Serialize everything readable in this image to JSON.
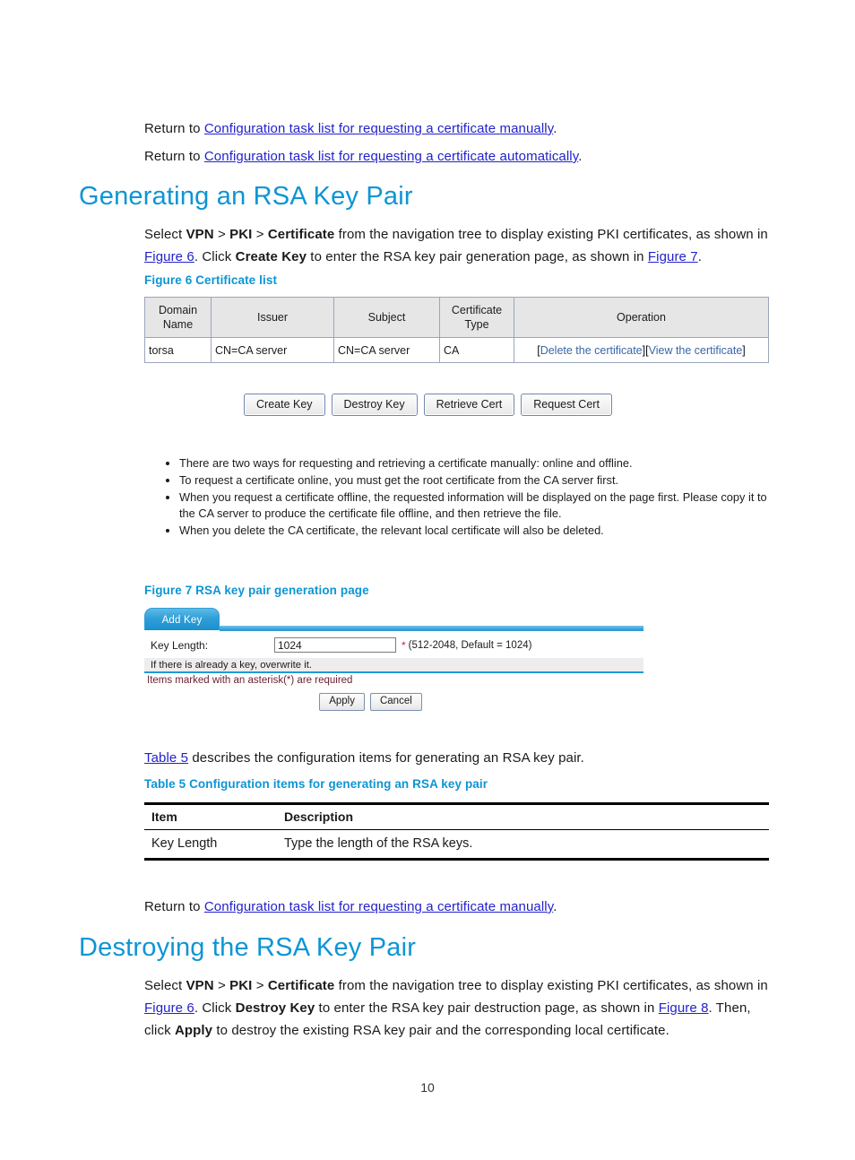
{
  "intro": {
    "return_line_1_prefix": "Return to ",
    "return_link_1": "Configuration task list for requesting a certificate manually",
    "return_line_1_suffix": ".",
    "return_line_2_prefix": "Return to ",
    "return_link_2": "Configuration task list for requesting a certificate automatically",
    "return_line_2_suffix": "."
  },
  "section_generating": {
    "heading": "Generating an RSA Key Pair",
    "body_1": "Select ",
    "nav_vpn": "VPN",
    "sep_1": " > ",
    "nav_pki": "PKI",
    "sep_2": " > ",
    "nav_certificate": "Certificate",
    "body_2": " from the navigation tree to display existing PKI certificates, as shown in ",
    "xref_figure6": "Figure 6",
    "body_3": ". Click ",
    "action_create_key": "Create Key",
    "body_4": " to enter the RSA key pair generation page, as shown in ",
    "xref_figure7": "Figure 7",
    "body_5": "."
  },
  "figure6": {
    "caption": "Figure 6 Certificate list",
    "table": {
      "headers": [
        "Domain Name",
        "Issuer",
        "Subject",
        "Certificate Type",
        "Operation"
      ],
      "rows": [
        {
          "domain_name": "torsa",
          "issuer": "CN=CA server",
          "subject": "CN=CA server",
          "certificate_type": "CA",
          "operations": [
            "Delete the certificate",
            "View the certificate"
          ]
        }
      ]
    },
    "buttons": [
      "Create Key",
      "Destroy Key",
      "Retrieve Cert",
      "Request Cert"
    ],
    "notes": [
      "There are two ways for requesting and retrieving a certificate manually: online and offline.",
      "To request a certificate online, you must get the root certificate from the CA server first.",
      "When you request a certificate offline, the requested information will be displayed on the page first. Please copy it to the CA server to produce the certificate file offline, and then retrieve the file.",
      "When you delete the CA certificate, the relevant local certificate will also be deleted."
    ]
  },
  "figure7": {
    "caption": "Figure 7 RSA key pair generation page",
    "tab_label": "Add Key",
    "key_length_label": "Key Length:",
    "key_length_value": "1024",
    "key_length_placeholder": "1024",
    "required_marker": "*",
    "key_length_hint": "(512-2048, Default = 1024)",
    "overwrite_note": "If there is already a key, overwrite it.",
    "asterisk_note": "Items marked with an asterisk(*) are required",
    "apply_label": "Apply",
    "cancel_label": "Cancel"
  },
  "table5_intro": {
    "xref_table5": "Table 5",
    "text": " describes the configuration items for generating an RSA key pair."
  },
  "table5": {
    "caption": "Table 5 Configuration items for generating an RSA key pair",
    "headers": [
      "Item",
      "Description"
    ],
    "rows": [
      {
        "item": "Key Length",
        "description": "Type the length of the RSA keys."
      }
    ]
  },
  "return_mid": {
    "prefix": "Return to ",
    "link": "Configuration task list for requesting a certificate manually",
    "suffix": "."
  },
  "section_destroying": {
    "heading": "Destroying the RSA Key Pair",
    "body_1": "Select ",
    "nav_vpn": "VPN",
    "sep_1": " > ",
    "nav_pki": "PKI",
    "sep_2": " > ",
    "nav_certificate": "Certificate",
    "body_2": " from the navigation tree to display existing PKI certificates, as shown in ",
    "xref_figure6": "Figure 6",
    "body_3": ". Click ",
    "action_destroy_key": "Destroy Key",
    "body_4": " to enter the RSA key pair destruction page, as shown in ",
    "xref_figure8": "Figure 8",
    "body_5": ". Then, click ",
    "action_apply": "Apply",
    "body_6": " to destroy the existing RSA key pair and the corresponding local certificate."
  },
  "footer": {
    "page_number": "10"
  },
  "colors": {
    "heading_blue": "#0d95d4",
    "caption_blue": "#0d95d4",
    "xref_blue": "#2222cc",
    "ui_link_blue": "#3a66a8",
    "required_red": "#cc1f3a",
    "tab_blue": "#2f9fd9",
    "table_header_gray": "#e6e6e6"
  }
}
